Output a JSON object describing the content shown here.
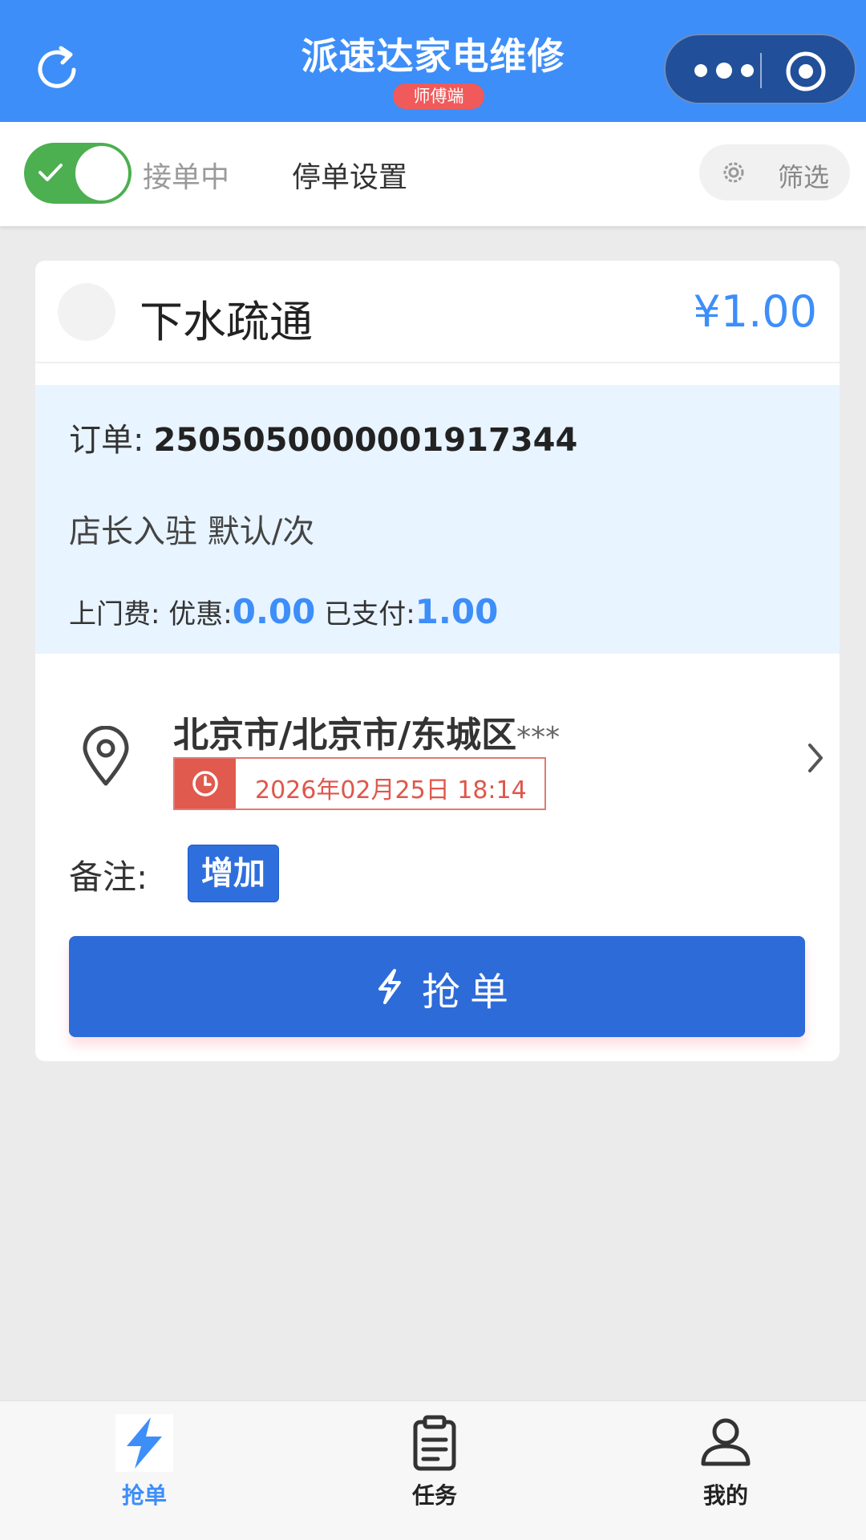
{
  "header": {
    "title": "派速达家电维修",
    "badge": "师傅端"
  },
  "toolbar": {
    "status": "接单中",
    "stop_setting": "停单设置",
    "filter": "筛选"
  },
  "card": {
    "service": "下水疏通",
    "price": "¥1.00",
    "order_label": "订单:",
    "order_no": "2505050000001917344",
    "shop_line": "店长入驻 默认/次",
    "fee_label": "上门费:",
    "discount_label": "优惠:",
    "discount_value": "0.00",
    "paid_label": "已支付:",
    "paid_value": "1.00",
    "address": "北京市/北京市/东城区",
    "address_mask": "***",
    "time": "2026年02月25日 18:14",
    "remark_label": "备注:",
    "add_btn": "增加",
    "grab_btn": "抢单"
  },
  "tabbar": {
    "items": [
      {
        "label": "抢单",
        "icon": "lightning-icon",
        "active": true
      },
      {
        "label": "任务",
        "icon": "clipboard-icon",
        "active": false
      },
      {
        "label": "我的",
        "icon": "user-icon",
        "active": false
      }
    ]
  },
  "colors": {
    "brand_blue": "#3d8ef9",
    "button_blue": "#2d6bd9",
    "switch_green": "#4caf50",
    "alert_red": "#e05a4e",
    "info_bg": "#e8f4ff"
  }
}
